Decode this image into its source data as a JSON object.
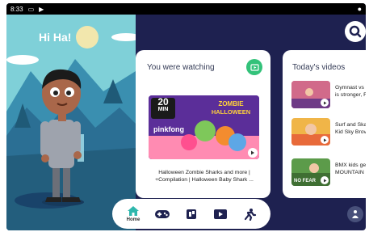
{
  "status_bar": {
    "time": "8:33",
    "icons": [
      "sim-icon",
      "play-store-icon"
    ]
  },
  "greeting": "Hi Ha!",
  "watching": {
    "title": "You were watching",
    "thumbnail": {
      "duration_badge_number": "20",
      "duration_badge_unit": "MIN",
      "headline_line1": "ZOMBIE",
      "headline_line2": "HALLOWEEN",
      "brand": "pinkfong"
    },
    "video_title": "Halloween Zombie Sharks and more | +Compilation | Halloween Baby Shark ..."
  },
  "today": {
    "title": "Today's videos",
    "items": [
      {
        "text_line1": "Gymnast vs",
        "text_line2": "is stronger, F"
      },
      {
        "text_line1": "Surf and Ska",
        "text_line2": "Kid Sky Brov"
      },
      {
        "text_line1": "BMX kids ge",
        "text_line2": "MOUNTAIN I",
        "thumb_label": "NO FEAR"
      }
    ]
  },
  "nav": {
    "items": [
      {
        "label": "Home",
        "icon": "home-icon",
        "active": true
      },
      {
        "label": "",
        "icon": "gamepad-icon",
        "active": false
      },
      {
        "label": "",
        "icon": "music-icon",
        "active": false
      },
      {
        "label": "",
        "icon": "video-icon",
        "active": false
      },
      {
        "label": "",
        "icon": "explore-icon",
        "active": false
      }
    ]
  },
  "colors": {
    "background": "#1e2150",
    "active_nav": "#2fb7ad",
    "badge_green": "#33c27a"
  }
}
